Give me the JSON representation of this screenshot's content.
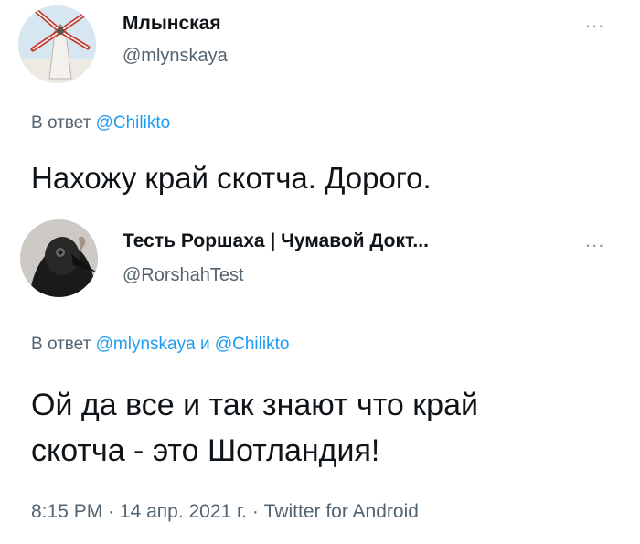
{
  "tweet1": {
    "display_name": "Млынская",
    "handle": "@mlynskaya",
    "reply_prefix": "В ответ",
    "reply_mentions": [
      "@Chilikto"
    ],
    "text": "Нахожу край скотча. Дорого.",
    "more_label": "..."
  },
  "tweet2": {
    "display_name": "Тесть Роршаха | Чумавой Докт...",
    "handle": "@RorshahTest",
    "reply_prefix": "В ответ",
    "reply_mentions": [
      "@mlynskaya",
      "@Chilikto"
    ],
    "reply_joiner": "и",
    "text_lines": [
      "Ой да все и так знают что край",
      "скотча - это Шотландия!"
    ],
    "more_label": "..."
  },
  "meta": {
    "time": "8:15 PM",
    "separator": "·",
    "date": "14 апр. 2021 г.",
    "source": "Twitter for Android"
  },
  "icons": {
    "avatar1": "windmill-avatar-icon",
    "avatar2": "plague-doctor-avatar-icon"
  },
  "colors": {
    "link": "#1d9bf0",
    "secondary_text": "#536471",
    "primary_text": "#0f1419"
  }
}
